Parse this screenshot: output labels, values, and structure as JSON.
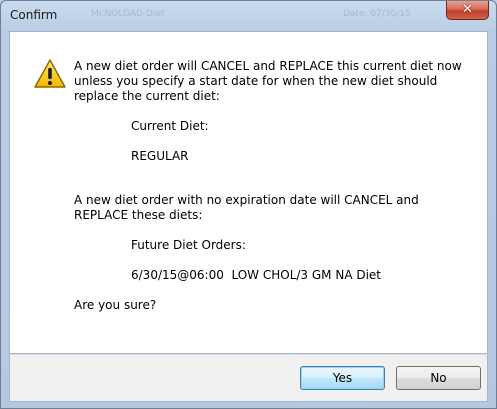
{
  "window": {
    "title": "Confirm",
    "close_glyph": "✕",
    "close_icon": "close-icon",
    "background_title_left": "Mr.NOLOAD Diet",
    "background_title_right": "Date: 07/30/15"
  },
  "dialog": {
    "icon": "warning-icon",
    "message_intro": "A new diet order will CANCEL and REPLACE this current diet now unless you specify a start date for when the new diet should replace the current diet:",
    "current_diet_label": "Current Diet:",
    "current_diet_value": "REGULAR",
    "replace_message": "A new diet order with no expiration date will CANCEL and REPLACE these diets:",
    "future_orders_label": "Future Diet Orders:",
    "future_order_item": "6/30/15@06:00  LOW CHOL/3 GM NA Diet",
    "question": "Are you sure?"
  },
  "buttons": {
    "yes": "Yes",
    "no": "No"
  },
  "colors": {
    "warning_fill": "#f5c400",
    "close_button": "#c0412b",
    "default_button_border": "#3c7fb1"
  }
}
